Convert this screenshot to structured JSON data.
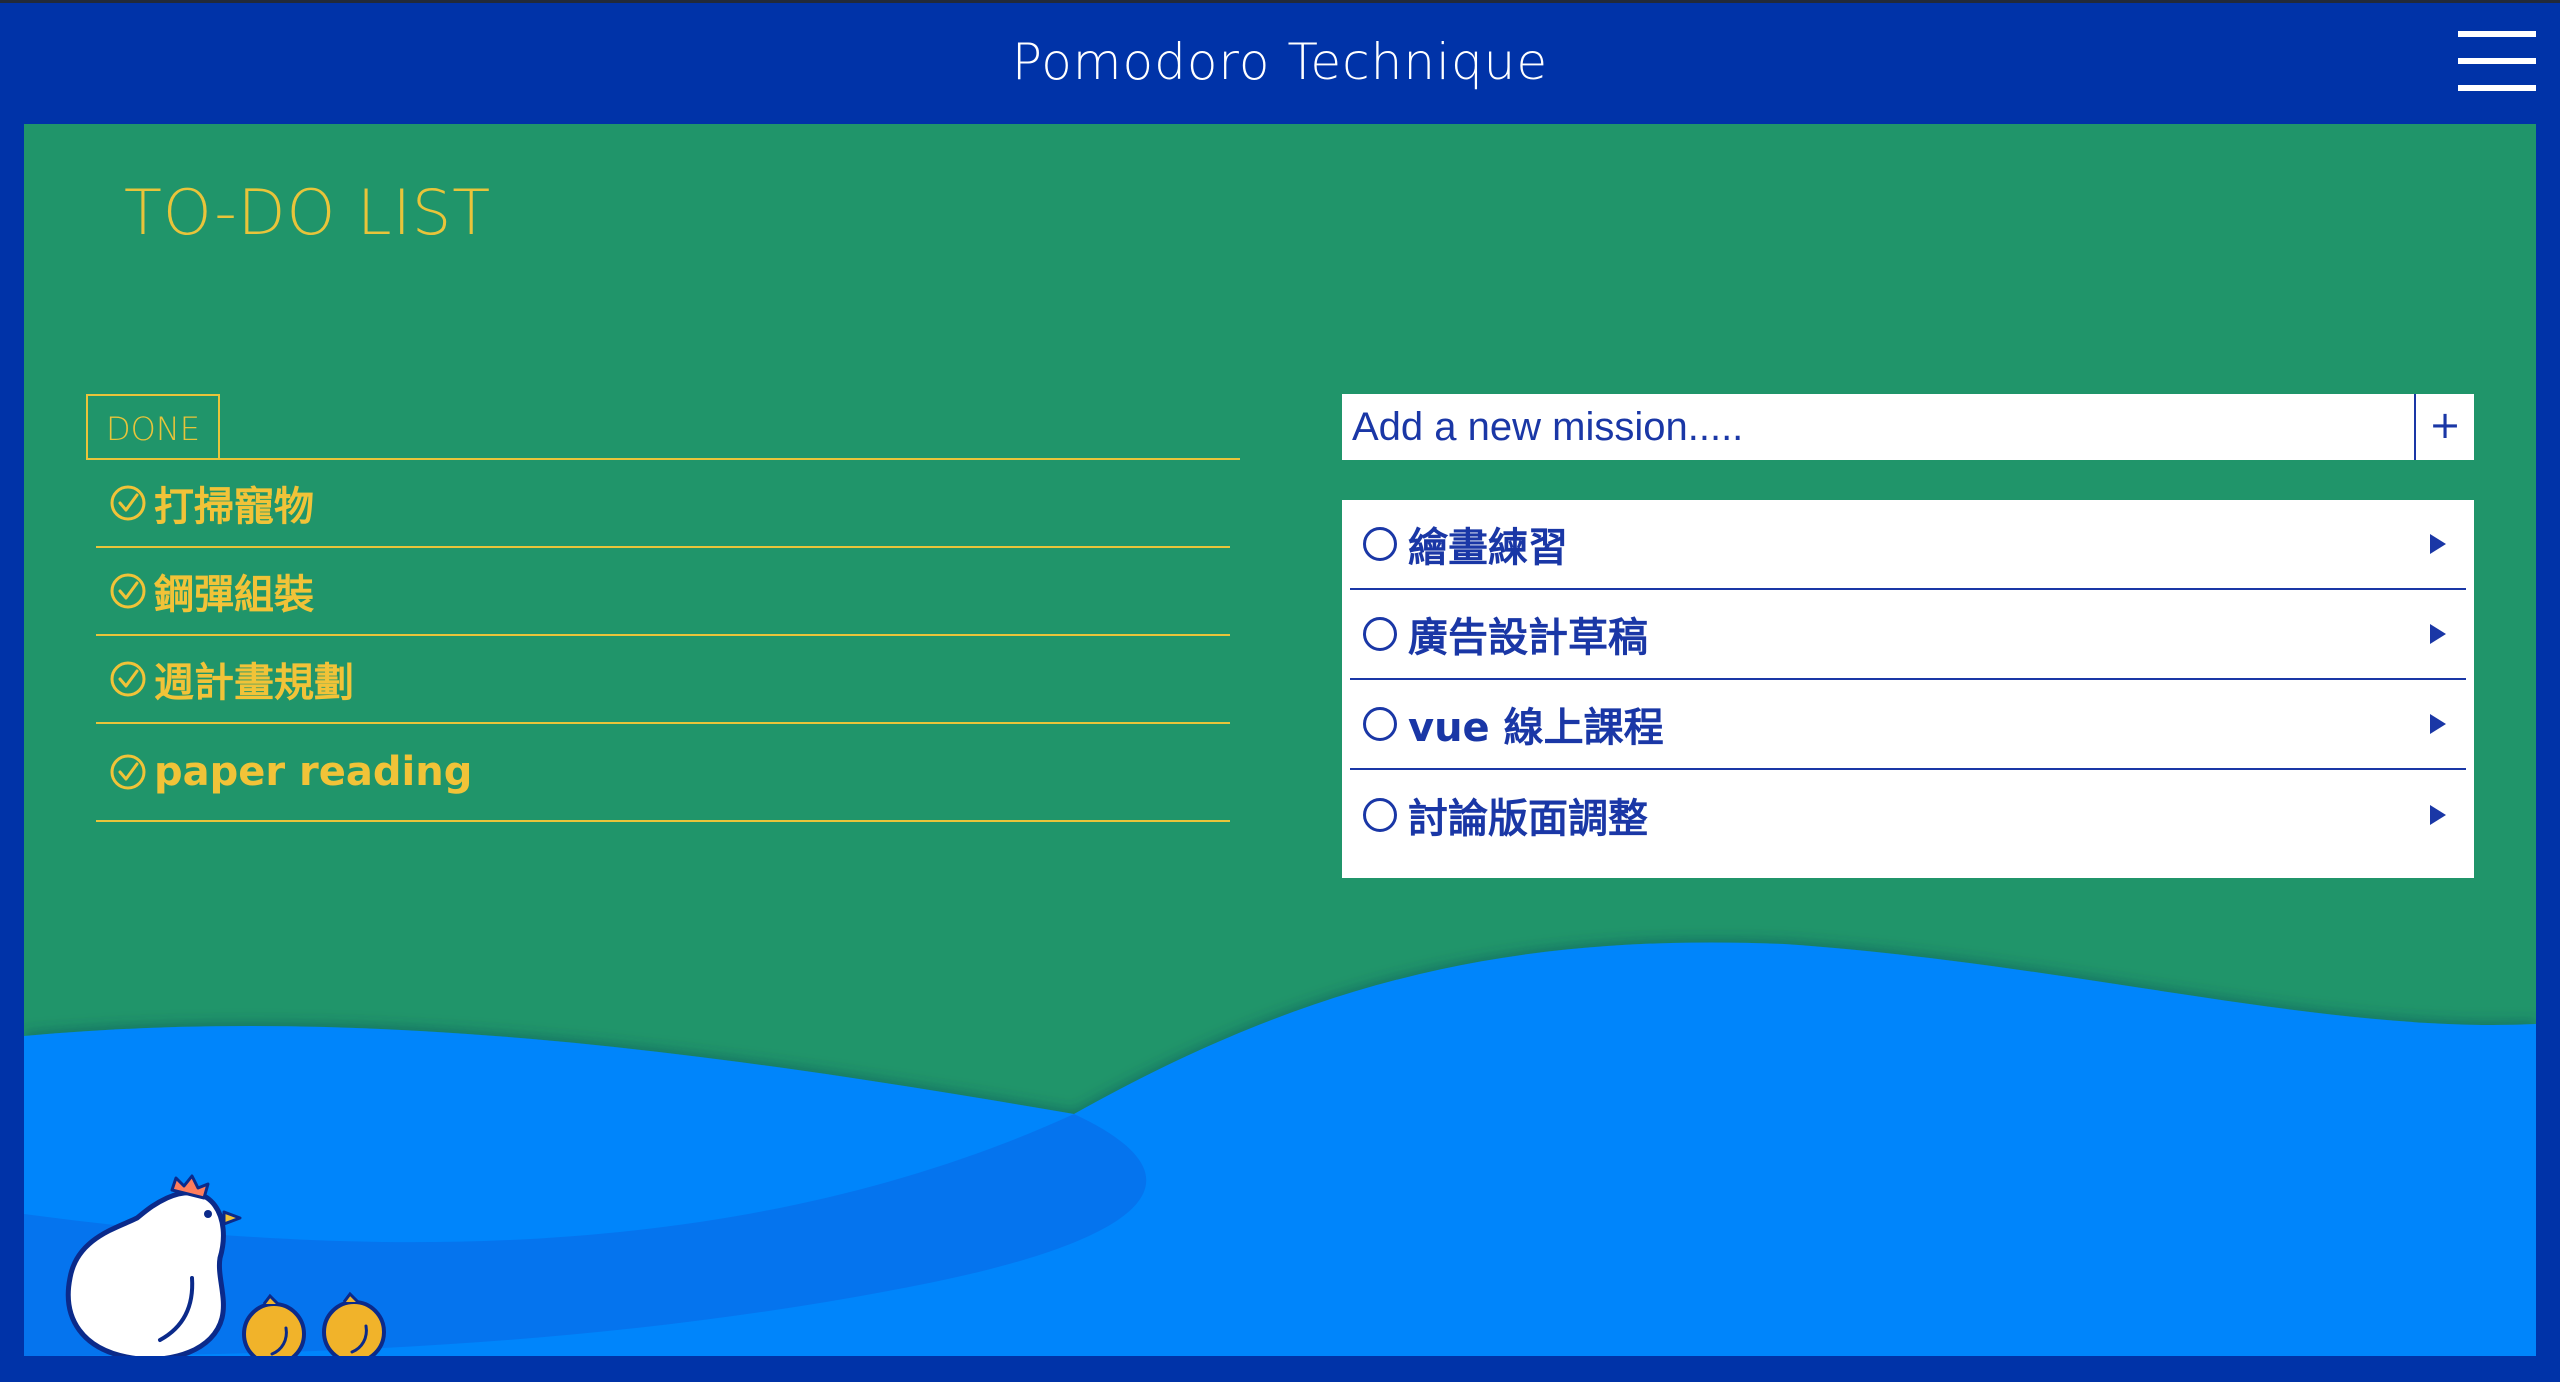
{
  "header": {
    "title": "Pomodoro Technique",
    "menu_icon": "hamburger-menu-icon"
  },
  "main": {
    "heading": "TO-DO LIST"
  },
  "done": {
    "tab_label": "DONE",
    "items": [
      {
        "label": "打掃寵物"
      },
      {
        "label": "鋼彈組裝"
      },
      {
        "label": "週計畫規劃"
      },
      {
        "label": "paper reading"
      }
    ]
  },
  "add_mission": {
    "placeholder": "Add a new mission.....",
    "add_label": "+"
  },
  "todo": {
    "items": [
      {
        "label": "繪畫練習"
      },
      {
        "label": "廣告設計草稿"
      },
      {
        "label": "vue 線上課程"
      },
      {
        "label": "討論版面調整"
      }
    ]
  },
  "colors": {
    "header_bg": "#0033a8",
    "main_bg": "#20956a",
    "accent_yellow": "#e9c43a",
    "todo_blue": "#1a37a6",
    "wave_blue": "#0185fb"
  }
}
